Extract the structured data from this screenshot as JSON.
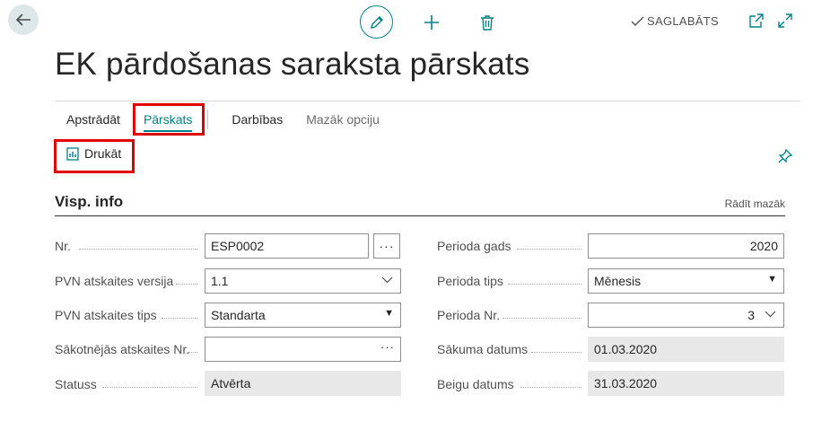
{
  "header": {
    "saved_label": "SAGLABĀTS",
    "page_title": "EK pārdošanas saraksta pārskats"
  },
  "tabs": [
    {
      "label": "Apstrādāt"
    },
    {
      "label": "Pārskats"
    },
    {
      "label": "Darbības"
    },
    {
      "label": "Mazāk opciju"
    }
  ],
  "actions": {
    "print_label": "Drukāt"
  },
  "section": {
    "title": "Visp. info",
    "show_less": "Rādīt mazāk"
  },
  "fields_left": [
    {
      "label": "Nr.",
      "value": "ESP0002"
    },
    {
      "label": "PVN atskaites versija",
      "value": "1.1"
    },
    {
      "label": "PVN atskaites tips",
      "value": "Standarta"
    },
    {
      "label": "Sākotnējās atskaites Nr.",
      "value": ""
    },
    {
      "label": "Statuss",
      "value": "Atvērta"
    }
  ],
  "fields_right": [
    {
      "label": "Perioda gads",
      "value": "2020"
    },
    {
      "label": "Perioda tips",
      "value": "Mēnesis"
    },
    {
      "label": "Perioda Nr.",
      "value": "3"
    },
    {
      "label": "Sākuma datums",
      "value": "01.03.2020"
    },
    {
      "label": "Beigu datums",
      "value": "31.03.2020"
    }
  ],
  "colors": {
    "accent": "#00828a",
    "highlight": "#e00000"
  }
}
